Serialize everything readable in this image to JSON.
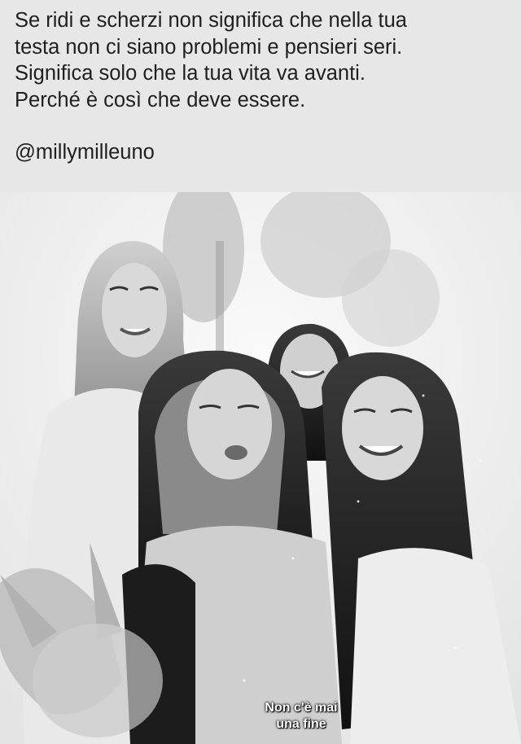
{
  "post": {
    "lines": [
      "Se ridi e scherzi non significa che nella tua",
      "testa non ci siano problemi e pensieri seri.",
      "Significa solo che la tua vita va avanti.",
      "Perché è così che deve essere."
    ],
    "handle": "@millymilleuno"
  },
  "photo": {
    "caption_line1": "Non c'è mai",
    "caption_line2": "una fine",
    "style": "black-and-white"
  }
}
